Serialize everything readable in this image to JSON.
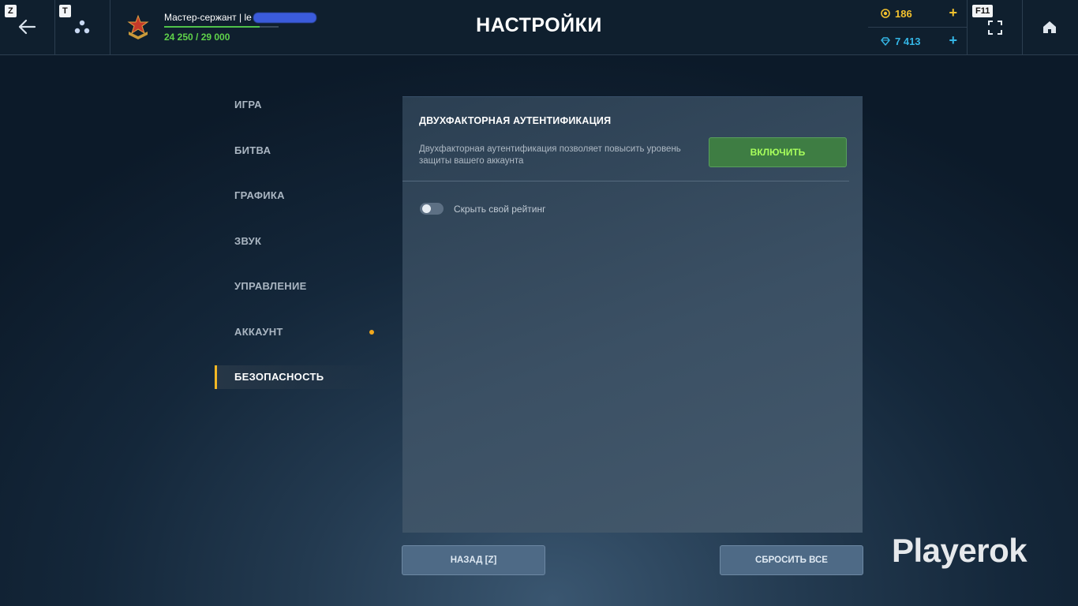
{
  "header": {
    "title": "НАСТРОЙКИ",
    "back_key": "Z",
    "social_key": "T",
    "fullscreen_key": "F11",
    "rank_title": "Мастер-сержант | le",
    "xp_text": "24 250 / 29 000",
    "xp_progress": 0.836,
    "gold_amount": "186",
    "gems_amount": "7 413",
    "plus_symbol": "+"
  },
  "sidebar": {
    "items": [
      {
        "label": "ИГРА"
      },
      {
        "label": "БИТВА"
      },
      {
        "label": "ГРАФИКА"
      },
      {
        "label": "ЗВУК"
      },
      {
        "label": "УПРАВЛЕНИЕ"
      },
      {
        "label": "АККАУНТ"
      },
      {
        "label": "БЕЗОПАСНОСТЬ"
      }
    ],
    "active_index": 6,
    "notification_index": 5
  },
  "panel": {
    "section_title": "ДВУХФАКТОРНАЯ АУТЕНТИФИКАЦИЯ",
    "section_description": "Двухфакторная аутентификация позволяет повысить уровень защиты вашего аккаунта",
    "enable_button": "ВКЛЮЧИТЬ",
    "toggle_label": "Скрыть свой рейтинг",
    "toggle_on": false
  },
  "footer": {
    "back_button": "НАЗАД [Z]",
    "reset_button": "СБРОСИТЬ ВСЕ"
  },
  "watermark": "Playerok",
  "colors": {
    "accent_yellow": "#f2b824",
    "gold": "#f2c12e",
    "gems": "#34b6e6",
    "xp_green": "#5fd24a",
    "enable_green": "#3e7d43"
  }
}
